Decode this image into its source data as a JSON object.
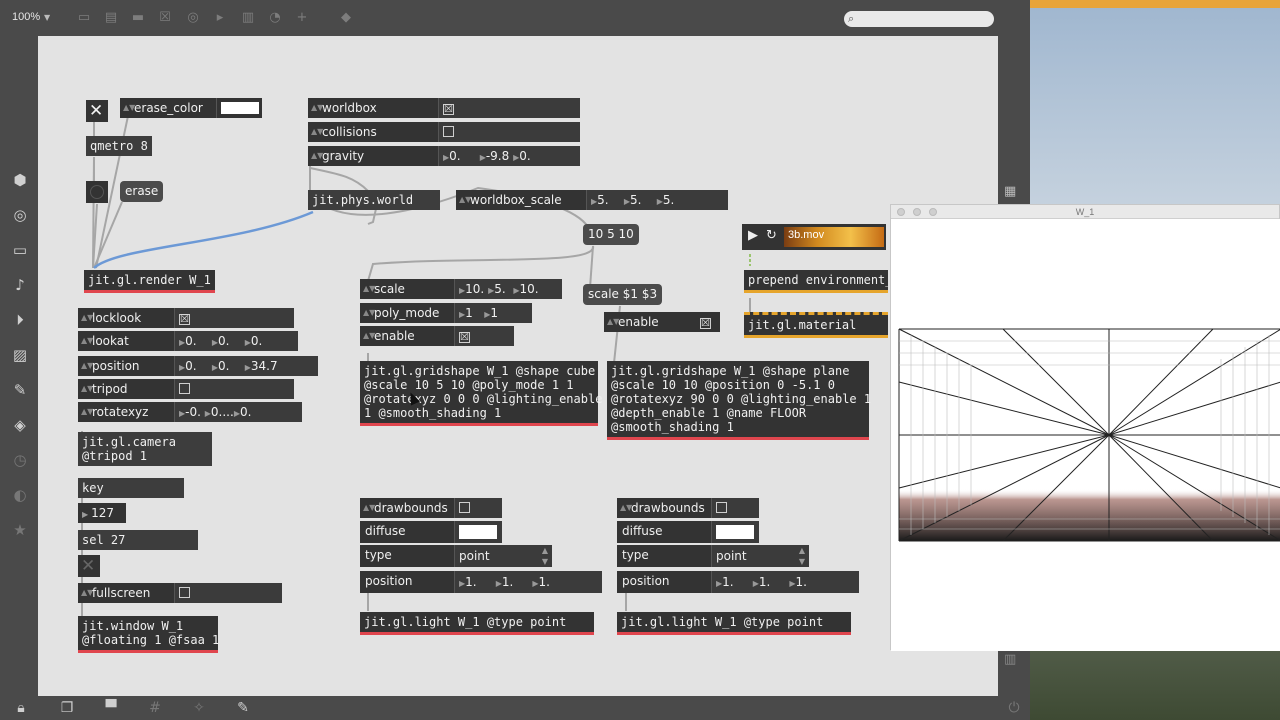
{
  "toolbar": {
    "zoom": "100%"
  },
  "colors": {
    "canvas": "#e3e3e3",
    "object": "#333333",
    "jit_border": "#e0464e",
    "cord_blue": "#6c99d6",
    "cord_grey": "#a6a6a6"
  },
  "objects": {
    "qmetro": "qmetro 8",
    "render": "jit.gl.render W_1",
    "phys_world": "jit.phys.world",
    "camera": "jit.gl.camera\n@tripod 1",
    "key": "key",
    "sel": "sel 27",
    "window": "jit.window W_1\n@floating 1 @fsaa 1",
    "gridshape_cube": "jit.gl.gridshape W_1 @shape cube\n@scale 10 5 10 @poly_mode 1 1\n@rotatexyz 0 0 0 @lighting_enable\n1 @smooth_shading 1",
    "gridshape_plane": "jit.gl.gridshape W_1 @shape plane\n@scale 10 10 @position 0 -5.1 0\n@rotatexyz 90 0 0 @lighting_enable 1\n@depth_enable 1 @name FLOOR\n@smooth_shading 1",
    "prepend": "prepend environment_t",
    "material": "jit.gl.material",
    "light1": "jit.gl.light W_1 @type point",
    "light2": "jit.gl.light W_1 @type point"
  },
  "messages": {
    "erase": "erase",
    "scale_vals": "10 5 10",
    "scale_fmt": "scale $1 $3"
  },
  "numbers": {
    "key_out": "127"
  },
  "attrs": {
    "erase_color": {
      "name": "erase_color"
    },
    "worldbox": {
      "name": "worldbox",
      "check": "☒"
    },
    "collisions": {
      "name": "collisions",
      "check": ""
    },
    "gravity": {
      "name": "gravity",
      "v1": "0.",
      "v2": "-9.8",
      "v3": "0."
    },
    "worldbox_scale": {
      "name": "worldbox_scale",
      "v1": "5.",
      "v2": "5.",
      "v3": "5."
    },
    "locklook": {
      "name": "locklook",
      "check": "☒"
    },
    "lookat": {
      "name": "lookat",
      "v1": "0.",
      "v2": "0.",
      "v3": "0."
    },
    "position_cam": {
      "name": "position",
      "v1": "0.",
      "v2": "0.",
      "v3": "34.7"
    },
    "tripod": {
      "name": "tripod",
      "check": ""
    },
    "rotatexyz": {
      "name": "rotatexyz",
      "v1": "-0.",
      "v2": "0....",
      "v3": "0."
    },
    "fullscreen": {
      "name": "fullscreen",
      "check": ""
    },
    "scale": {
      "name": "scale",
      "v1": "10.",
      "v2": "5.",
      "v3": "10."
    },
    "poly_mode": {
      "name": "poly_mode",
      "v1": "1",
      "v2": "1"
    },
    "enable1": {
      "name": "enable",
      "check": "☒"
    },
    "enable2": {
      "name": "enable",
      "check": "☒"
    },
    "drawbounds1": {
      "name": "drawbounds",
      "check": ""
    },
    "diffuse1": {
      "name": "diffuse"
    },
    "type1": {
      "name": "type",
      "value": "point"
    },
    "position1": {
      "name": "position",
      "v1": "1.",
      "v2": "1.",
      "v3": "1."
    },
    "drawbounds2": {
      "name": "drawbounds",
      "check": ""
    },
    "diffuse2": {
      "name": "diffuse"
    },
    "type2": {
      "name": "type",
      "value": "point"
    },
    "position2": {
      "name": "position",
      "v1": "1.",
      "v2": "1.",
      "v3": "1."
    }
  },
  "movie": {
    "file": "3b.mov"
  },
  "jit_window": {
    "title": "W_1"
  }
}
